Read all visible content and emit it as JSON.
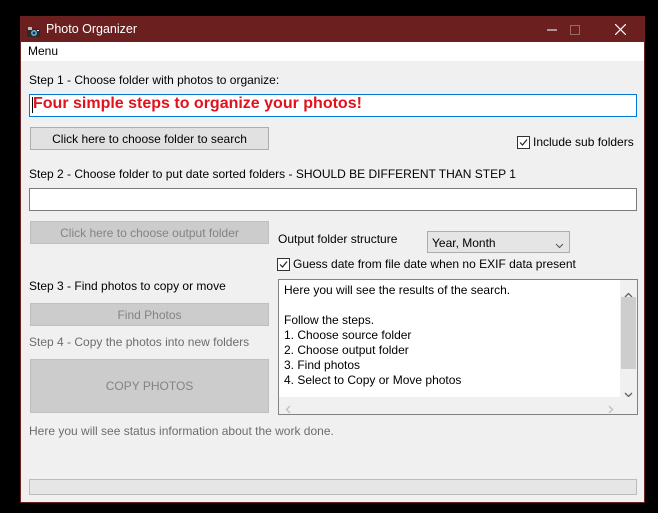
{
  "window": {
    "title": "Photo Organizer",
    "title_icon": "camera-icon",
    "controls": [
      "minimize-icon",
      "maximize-icon",
      "close-icon"
    ]
  },
  "menu": {
    "items": [
      {
        "label": "Menu"
      }
    ]
  },
  "step1": {
    "label": "Step 1 - Choose folder with photos to organize:",
    "source_folder_value": "Four simple steps to organize your photos!",
    "choose_button": "Click here to choose folder to search",
    "include_sub_folders": {
      "label": "Include sub folders",
      "checked": true
    }
  },
  "step2": {
    "label": "Step 2 - Choose folder to put date sorted folders - SHOULD BE DIFFERENT THAN STEP 1",
    "output_folder_value": "",
    "choose_button": "Click here to choose output folder",
    "structure_label": "Output folder structure",
    "structure_selected": "Year, Month",
    "guess_date": {
      "label": "Guess date from file date when no EXIF data present",
      "checked": true
    }
  },
  "step3": {
    "label": "Step 3 - Find photos to copy or move",
    "find_button": "Find Photos"
  },
  "step4": {
    "label": "Step 4 - Copy the photos into new folders",
    "copy_button": "COPY PHOTOS"
  },
  "results": {
    "lines": [
      "Here you will see the results of the search.",
      "",
      "Follow the steps.",
      "1. Choose source folder",
      "2. Choose output folder",
      "3. Find photos",
      "4. Select to Copy or Move photos"
    ]
  },
  "status": {
    "text": "Here you will see status information about the work done.",
    "progress": 0
  }
}
